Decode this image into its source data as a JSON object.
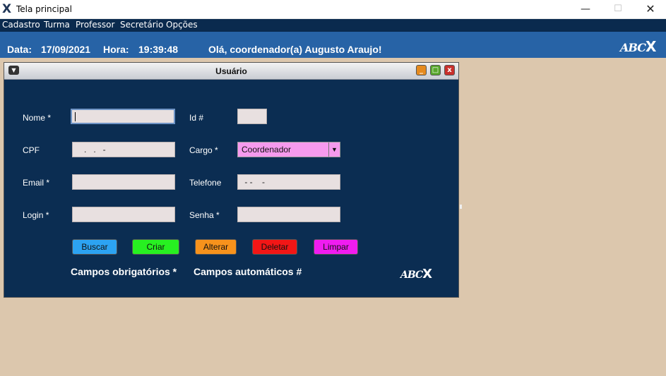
{
  "window": {
    "title": "Tela principal",
    "controls": {
      "minimize": "—",
      "maximize": "☐",
      "close": "✕"
    }
  },
  "menu": [
    "Cadastro",
    "Turma",
    "Professor",
    "Secretário",
    "Opções"
  ],
  "header": {
    "date_label": "Data:",
    "date": "17/09/2021",
    "time_label": "Hora:",
    "time": "19:39:48",
    "greeting": "Olá, coordenador(a) Augusto Araujo!",
    "logo": {
      "text": "ABC",
      "mark": "X"
    }
  },
  "form": {
    "title": "Usuário",
    "fields": {
      "nome": {
        "label": "Nome *",
        "value": ""
      },
      "id": {
        "label": "Id #",
        "value": ""
      },
      "cpf": {
        "label": "CPF",
        "value": "   .   .   -"
      },
      "cargo": {
        "label": "Cargo *",
        "value": "Coordenador"
      },
      "email": {
        "label": "Email *",
        "value": ""
      },
      "telefone": {
        "label": "Telefone",
        "value": " - -    -"
      },
      "login": {
        "label": "Login *",
        "value": ""
      },
      "senha": {
        "label": "Senha *",
        "value": ""
      }
    },
    "buttons": {
      "buscar": "Buscar",
      "criar": "Criar",
      "alterar": "Alterar",
      "deletar": "Deletar",
      "limpar": "Limpar"
    },
    "footer": {
      "required": "Campos obrigatórios *",
      "automatic": "Campos automáticos #"
    },
    "logo": {
      "text": "ABC",
      "mark": "X"
    }
  },
  "colors": {
    "menubar": "#0a2a4e",
    "header": "#2763a6",
    "form_bg": "#0b2d52",
    "desktop": "#dcc7ad",
    "buscar": "#2ca3f2",
    "criar": "#27f021",
    "alterar": "#f7921c",
    "deletar": "#f21616",
    "limpar": "#f01cf0",
    "cargo_combo": "#f69aee"
  }
}
